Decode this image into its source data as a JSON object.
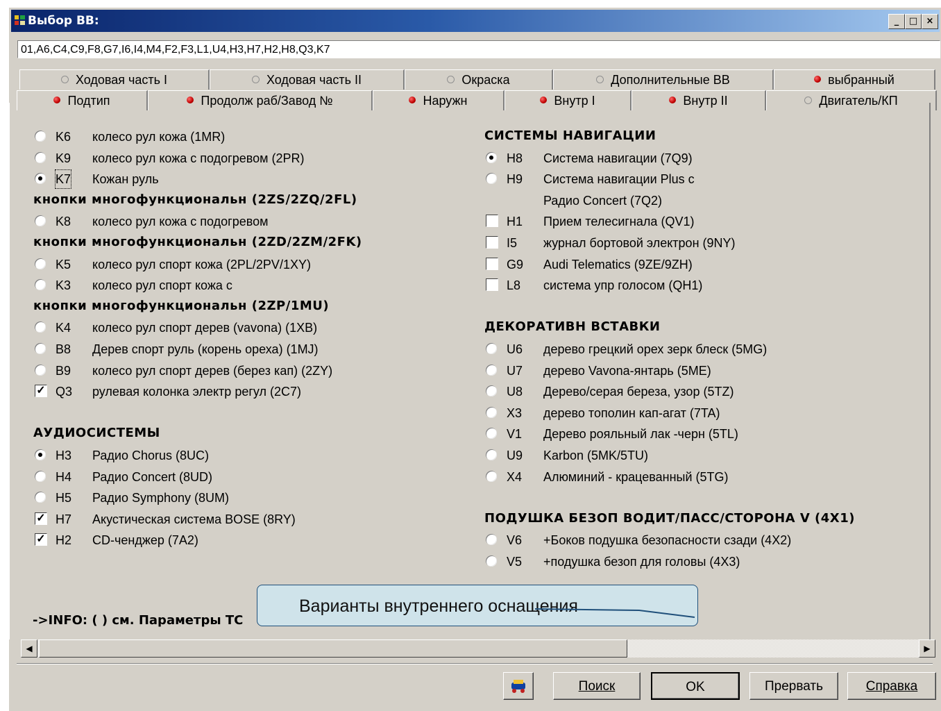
{
  "window": {
    "title": "Выбор ВВ:",
    "minimize": "_",
    "maximize": "□",
    "close": "×"
  },
  "codes_field": "01,A6,C4,C9,F8,G7,I6,I4,M4,F2,F3,L1,U4,H3,H7,H2,H8,Q3,K7",
  "tabs_row1": [
    {
      "label": "Ходовая часть I",
      "marked": false
    },
    {
      "label": "Ходовая часть II",
      "marked": false
    },
    {
      "label": "Окраска",
      "marked": false
    },
    {
      "label": "Дополнительные ВВ",
      "marked": false
    },
    {
      "label": "выбранный",
      "marked": true
    }
  ],
  "tabs_row2": [
    {
      "label": "Подтип",
      "marked": true
    },
    {
      "label": "Продолж раб/Завод №",
      "marked": true
    },
    {
      "label": "Наружн",
      "marked": true
    },
    {
      "label": "Внутр I",
      "marked": true
    },
    {
      "label": "Внутр II",
      "marked": true
    },
    {
      "label": "Двигатель/КП",
      "marked": false
    }
  ],
  "left": {
    "items": [
      {
        "type": "radio",
        "checked": false,
        "code": "K6",
        "desc": "колесо рул кожа (1MR)"
      },
      {
        "type": "radio",
        "checked": false,
        "code": "K9",
        "desc": "колесо рул кожа с подогревом (2PR)"
      },
      {
        "type": "radio",
        "checked": true,
        "code": "K7",
        "desc": "Кожан руль"
      },
      {
        "type": "header",
        "text": "кнопки многофункциональн (2ZS/2ZQ/2FL)"
      },
      {
        "type": "radio",
        "checked": false,
        "code": "K8",
        "desc": "колесо рул кожа с подогревом"
      },
      {
        "type": "header",
        "text": "кнопки многофункциональн (2ZD/2ZM/2FK)"
      },
      {
        "type": "radio",
        "checked": false,
        "code": "K5",
        "desc": "колесо рул спорт кожа (2PL/2PV/1XY)"
      },
      {
        "type": "radio",
        "checked": false,
        "code": "K3",
        "desc": "колесо рул спорт кожа с"
      },
      {
        "type": "header",
        "text": "кнопки многофункциональн (2ZP/1MU)"
      },
      {
        "type": "radio",
        "checked": false,
        "code": "K4",
        "desc": "колесо рул спорт дерев (vavona) (1XB)"
      },
      {
        "type": "radio",
        "checked": false,
        "code": "B8",
        "desc": "Дерев спорт руль (корень ореха) (1MJ)"
      },
      {
        "type": "radio",
        "checked": false,
        "code": "B9",
        "desc": "колесо рул спорт дерев (берез кап) (2ZY)"
      },
      {
        "type": "check",
        "checked": true,
        "code": "Q3",
        "desc": "рулевая колонка электр регул (2C7)"
      },
      {
        "type": "blank"
      },
      {
        "type": "header",
        "text": "АУДИОСИСТЕМЫ"
      },
      {
        "type": "radio",
        "checked": true,
        "code": "H3",
        "desc": "Радио Chorus (8UC)"
      },
      {
        "type": "radio",
        "checked": false,
        "code": "H4",
        "desc": "Радио Concert (8UD)"
      },
      {
        "type": "radio",
        "checked": false,
        "code": "H5",
        "desc": "Радио Symphony (8UM)"
      },
      {
        "type": "check",
        "checked": true,
        "code": "H7",
        "desc": "Акустическая система BOSE (8RY)"
      },
      {
        "type": "check",
        "checked": true,
        "code": "H2",
        "desc": "CD-ченджер (7A2)"
      }
    ]
  },
  "right": {
    "items": [
      {
        "type": "header",
        "text": "СИСТЕМЫ НАВИГАЦИИ"
      },
      {
        "type": "radio",
        "checked": true,
        "code": "H8",
        "desc": "Система навигации (7Q9)"
      },
      {
        "type": "radio",
        "checked": false,
        "code": "H9",
        "desc": "Система навигации Plus с"
      },
      {
        "type": "cont",
        "desc": "Радио Concert (7Q2)"
      },
      {
        "type": "check",
        "checked": false,
        "code": "H1",
        "desc": "Прием телесигнала (QV1)"
      },
      {
        "type": "check",
        "checked": false,
        "code": "I5",
        "desc": "журнал бортовой электрон (9NY)"
      },
      {
        "type": "check",
        "checked": false,
        "code": "G9",
        "desc": "Audi Telematics (9ZE/9ZH)"
      },
      {
        "type": "check",
        "checked": false,
        "code": "L8",
        "desc": "система упр голосом (QH1)"
      },
      {
        "type": "blank"
      },
      {
        "type": "header",
        "text": "ДЕКОРАТИВН ВСТАВКИ"
      },
      {
        "type": "radio",
        "checked": false,
        "code": "U6",
        "desc": "дерево грецкий орех зерк блеск (5MG)"
      },
      {
        "type": "radio",
        "checked": false,
        "code": "U7",
        "desc": "дерево Vavona-янтарь (5ME)"
      },
      {
        "type": "radio",
        "checked": false,
        "code": "U8",
        "desc": "Дерево/серая береза, узор (5TZ)"
      },
      {
        "type": "radio",
        "checked": false,
        "code": "X3",
        "desc": "дерево тополин кап-агат (7TA)"
      },
      {
        "type": "radio",
        "checked": false,
        "code": "V1",
        "desc": "Дерево рояльный лак -черн (5TL)"
      },
      {
        "type": "radio",
        "checked": false,
        "code": "U9",
        "desc": "Karbon (5MK/5TU)"
      },
      {
        "type": "radio",
        "checked": false,
        "code": "X4",
        "desc": "Алюминий - крацеванный (5TG)"
      },
      {
        "type": "blank"
      },
      {
        "type": "header",
        "text": "ПОДУШКА БЕЗОП ВОДИТ/ПАСС/СТОРОНА V (4X1)"
      },
      {
        "type": "radio",
        "checked": false,
        "code": "V6",
        "desc": "+Боков подушка безопасности сзади (4X2)"
      },
      {
        "type": "radio",
        "checked": false,
        "code": "V5",
        "desc": " +подушка безоп для головы (4X3)"
      }
    ]
  },
  "info": "->INFO:  ( ) см. Параметры ТС",
  "callout": "Варианты внутреннего оснащения",
  "buttons": {
    "search": "Поиск",
    "ok": "OK",
    "abort": "Прервать",
    "help": "Справка"
  }
}
